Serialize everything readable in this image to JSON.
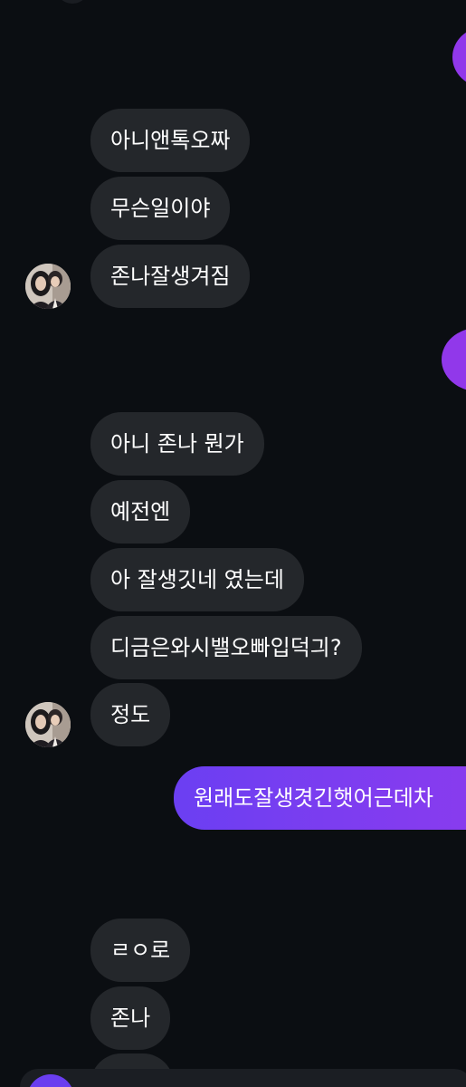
{
  "conversation": {
    "messages": [
      {
        "sender": "them",
        "text": "아니앤톡오짜"
      },
      {
        "sender": "them",
        "text": "무슨일이야"
      },
      {
        "sender": "them",
        "text": "존나잘생겨짐"
      },
      {
        "sender": "them",
        "text": "아니 존나 뭔가"
      },
      {
        "sender": "them",
        "text": "예전엔"
      },
      {
        "sender": "them",
        "text": "아 잘생깃네 였는데"
      },
      {
        "sender": "them",
        "text": "디금은와시밸오빠입덕긔?"
      },
      {
        "sender": "them",
        "text": "정도"
      },
      {
        "sender": "me",
        "text": "원래도잘생겻긴햇어근데차"
      },
      {
        "sender": "them",
        "text": "ㄹㅇ로"
      },
      {
        "sender": "them",
        "text": "존나"
      }
    ]
  },
  "theme": {
    "background": "#0b0e12",
    "received_bubble": "#24272b",
    "sent_bubble": "#7c3df0",
    "text": "#ffffff"
  },
  "icons": {
    "avatar": "contact-avatar-photo",
    "composer_action": "plus-button-icon"
  }
}
